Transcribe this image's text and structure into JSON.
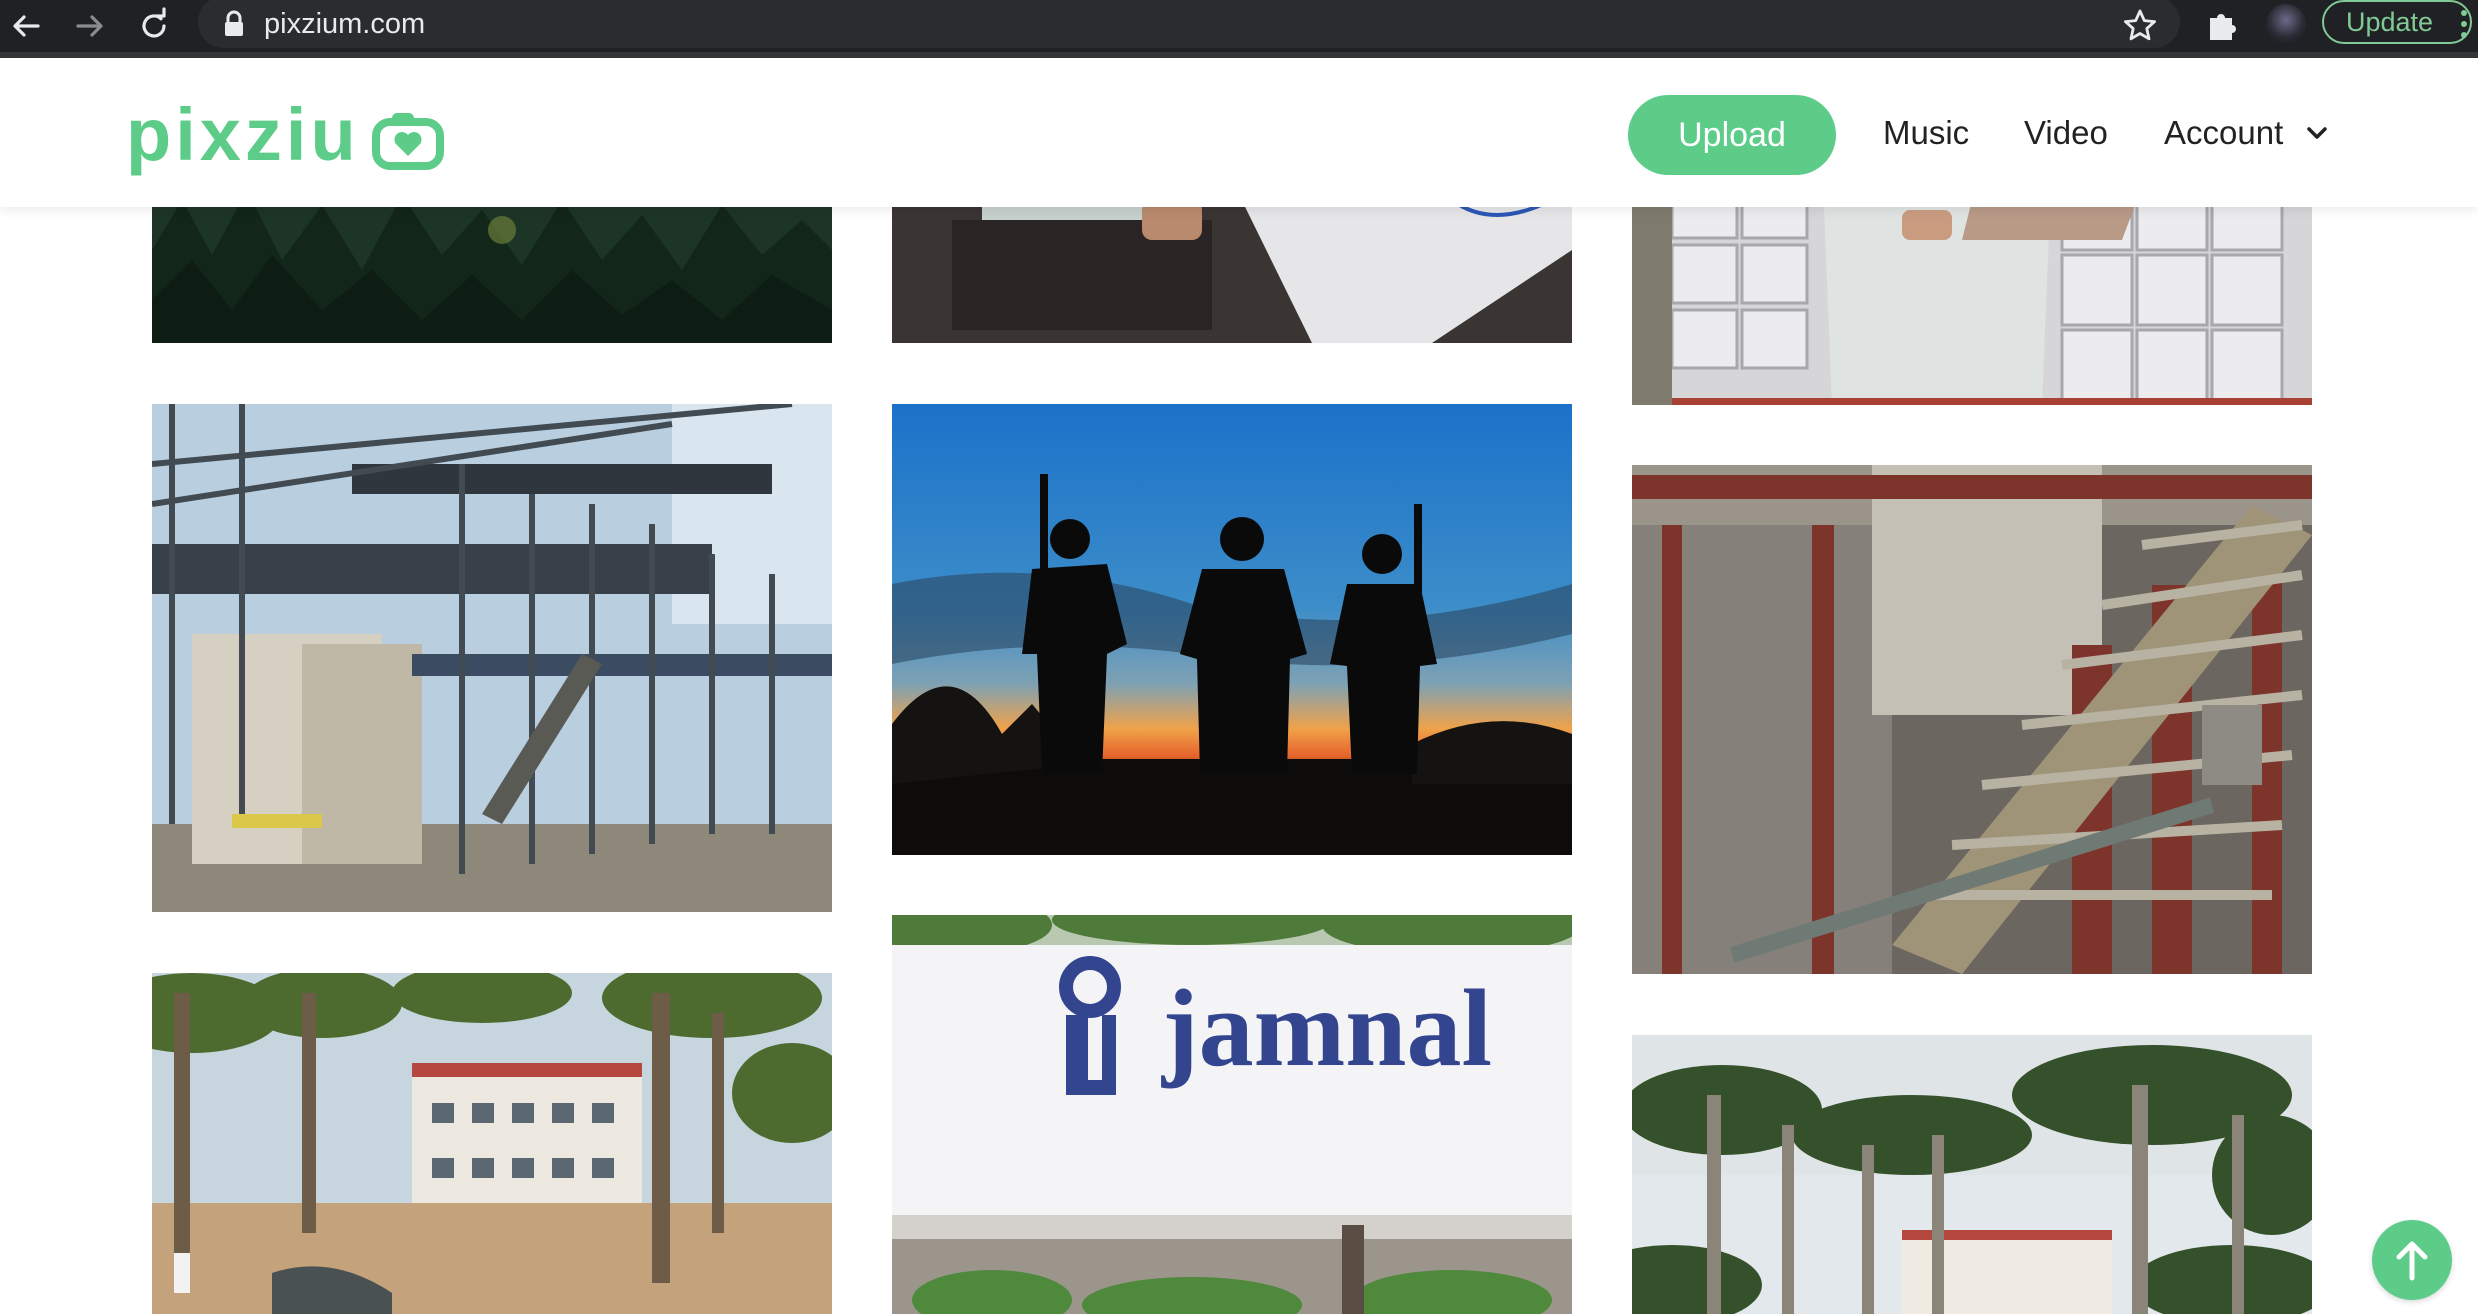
{
  "browser": {
    "url": "pixzium.com",
    "update_label": "Update",
    "icons": [
      "back-arrow-icon",
      "forward-arrow-icon",
      "reload-icon",
      "lock-icon",
      "star-icon",
      "extensions-puzzle-icon",
      "profile-avatar",
      "more-menu-icon"
    ]
  },
  "header": {
    "logo_text": "pixziu",
    "nav": {
      "upload": "Upload",
      "music": "Music",
      "video": "Video",
      "account": "Account"
    }
  },
  "gallery": {
    "tiles": [
      {
        "name": "pine-forest-photo",
        "column": 1
      },
      {
        "name": "person-at-laptop-desk-photo",
        "column": 2
      },
      {
        "name": "person-holding-laptop-lockers-photo",
        "column": 3
      },
      {
        "name": "industrial-plant-pipes-photo",
        "column": 1
      },
      {
        "name": "soldiers-silhouette-sunset-photo",
        "column": 2
      },
      {
        "name": "rusty-conveyor-machinery-photo",
        "column": 3
      },
      {
        "name": "palm-trees-building-photo",
        "column": 1
      },
      {
        "name": "jamnal-sign-wall-photo",
        "column": 2,
        "sign_text": "jamnal"
      },
      {
        "name": "palm-trees-campus-photo",
        "column": 3
      }
    ]
  },
  "colors": {
    "brand_green": "#5ccc88",
    "browser_bar": "#202124",
    "update_green": "#81c995"
  }
}
